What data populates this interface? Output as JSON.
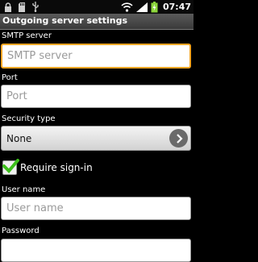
{
  "status_bar": {
    "time": "07:47",
    "icons": [
      "lock-notification-icon",
      "sd-card-icon",
      "usb-icon",
      "wifi-icon",
      "signal-icon",
      "battery-charging-icon"
    ]
  },
  "title": "Outgoing server settings",
  "smtp": {
    "label": "SMTP server",
    "placeholder": "SMTP server"
  },
  "port": {
    "label": "Port",
    "placeholder": "Port"
  },
  "security": {
    "label": "Security type",
    "value": "None"
  },
  "require_signin": {
    "label": "Require sign-in",
    "checked": true
  },
  "username": {
    "label": "User name",
    "placeholder": "User name"
  },
  "password": {
    "label": "Password"
  },
  "colors": {
    "focus": "#f5a623",
    "check": "#3cbf1a",
    "battery": "#8bd43a"
  }
}
